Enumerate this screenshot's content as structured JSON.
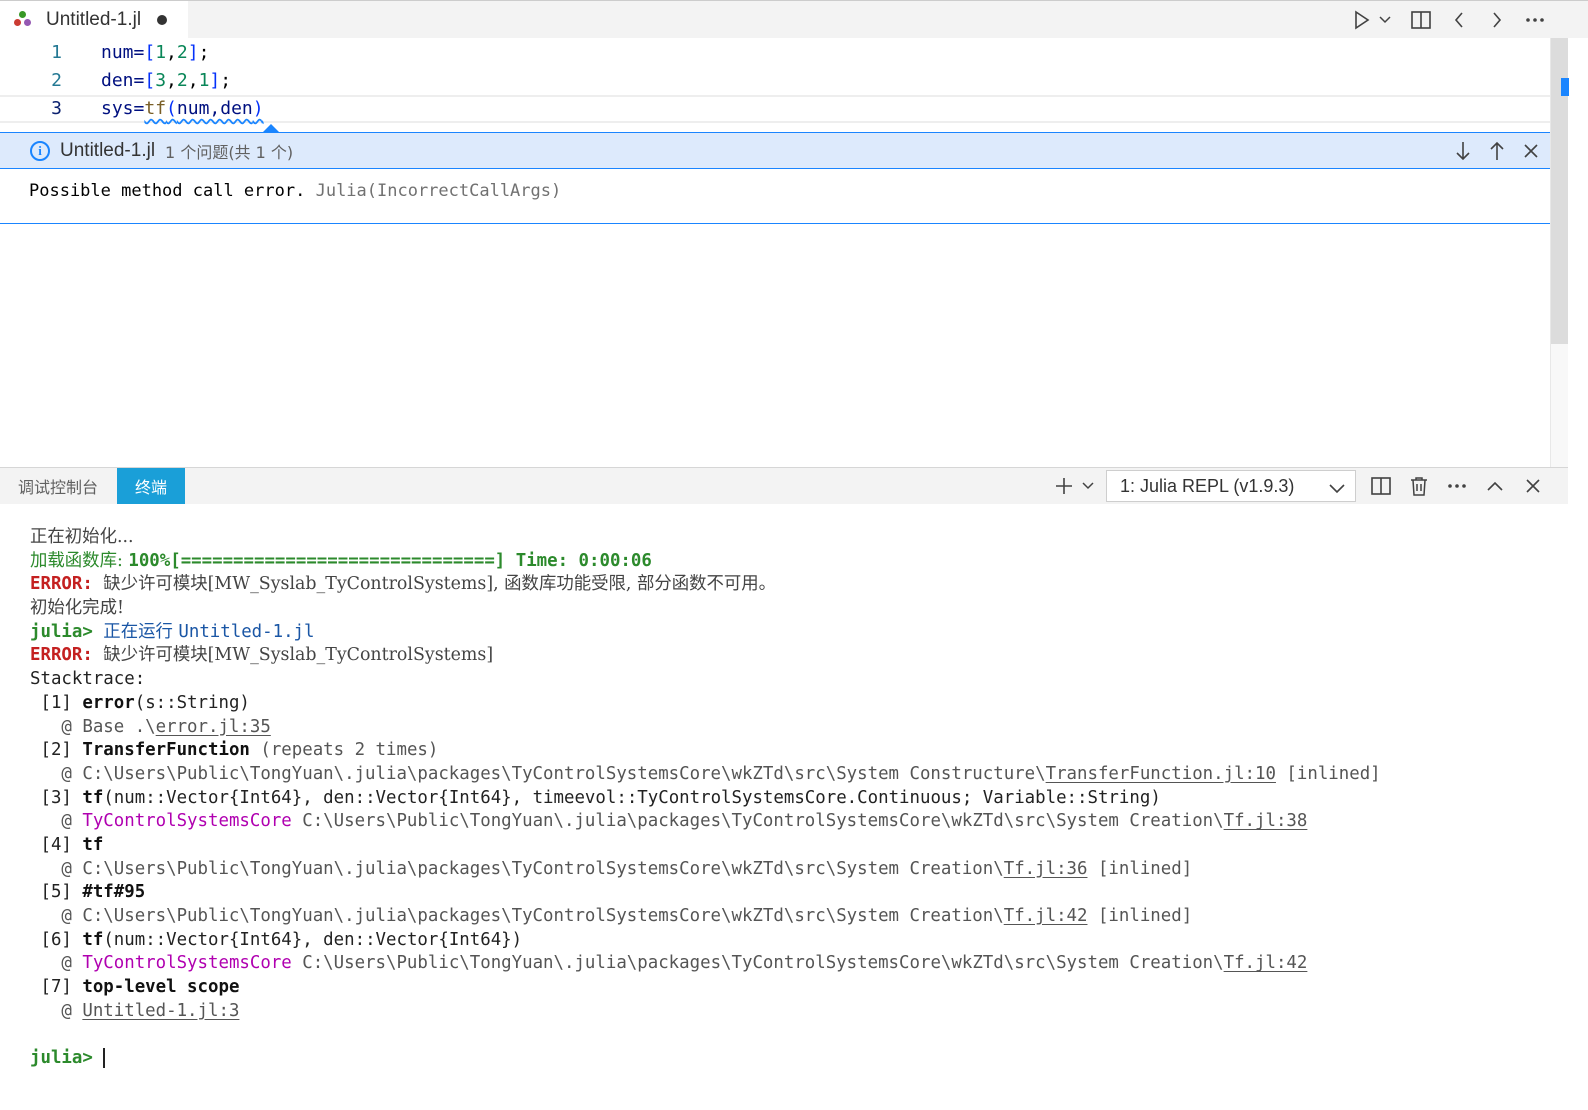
{
  "tab": {
    "title": "Untitled-1.jl"
  },
  "editor": {
    "lines": [
      {
        "no": "1",
        "text": "num=[1,2];"
      },
      {
        "no": "2",
        "text": "den=[3,2,1];"
      },
      {
        "no": "3",
        "text": "sys=tf(num,den)"
      }
    ],
    "tokens": {
      "l1": [
        "num=",
        "[",
        "1",
        ",",
        "2",
        "]",
        ";"
      ],
      "l2": [
        "den=",
        "[",
        "3",
        ",",
        "2",
        ",",
        "1",
        "]",
        ";"
      ],
      "l3": [
        "sys=",
        "tf",
        "(",
        "num,den",
        ")"
      ]
    }
  },
  "problems_peek": {
    "file": "Untitled-1.jl",
    "count": "1 个问题(共 1 个)",
    "message": "Possible method call error.",
    "source": "Julia(IncorrectCallArgs)"
  },
  "panel": {
    "tabs": {
      "debug": "调试控制台",
      "terminal": "终端"
    },
    "terminal_select": "1: Julia REPL (v1.9.3)"
  },
  "terminal": {
    "init": "正在初始化...",
    "loading_label": "加载函数库: ",
    "loading_progress": "100%[==============================]",
    "loading_time": " Time: 0:00:06",
    "error_label": "ERROR: ",
    "error1_msg": "缺少许可模块[MW_Syslab_TyControlSystems], 函数库功能受限, 部分函数不可用。",
    "init_done": "初始化完成!",
    "prompt": "julia> ",
    "running": "正在运行 ",
    "running_file": "Untitled-1.jl",
    "error2_msg": "缺少许可模块[MW_Syslab_TyControlSystems]",
    "stacktrace": "Stacktrace:",
    "frames": {
      "f1_idx": " [1] ",
      "f1_fn": "error",
      "f1_args": "(s::String)",
      "f1_at": "   @ Base .\\",
      "f1_file": "error.jl:35",
      "f2_idx": " [2] ",
      "f2_fn": "TransferFunction",
      "f2_rest": " (repeats 2 times)",
      "f2_at": "   @ C:\\Users\\Public\\TongYuan\\.julia\\packages\\TyControlSystemsCore\\wkZTd\\src\\System Constructure\\",
      "f2_file": "TransferFunction.jl:10",
      "f2_tail": " [inlined]",
      "f3_idx": " [3] ",
      "f3_fn": "tf",
      "f3_args": "(num::Vector{Int64}, den::Vector{Int64}, timeevol::TyControlSystemsCore.Continuous; Variable::String)",
      "f3_at": "   @ ",
      "f3_mod": "TyControlSystemsCore",
      "f3_path": " C:\\Users\\Public\\TongYuan\\.julia\\packages\\TyControlSystemsCore\\wkZTd\\src\\System Creation\\",
      "f3_file": "Tf.jl:38",
      "f4_idx": " [4] ",
      "f4_fn": "tf",
      "f4_at": "   @ C:\\Users\\Public\\TongYuan\\.julia\\packages\\TyControlSystemsCore\\wkZTd\\src\\System Creation\\",
      "f4_file": "Tf.jl:36",
      "f4_tail": " [inlined]",
      "f5_idx": " [5] ",
      "f5_fn": "#tf#95",
      "f5_at": "   @ C:\\Users\\Public\\TongYuan\\.julia\\packages\\TyControlSystemsCore\\wkZTd\\src\\System Creation\\",
      "f5_file": "Tf.jl:42",
      "f5_tail": " [inlined]",
      "f6_idx": " [6] ",
      "f6_fn": "tf",
      "f6_args": "(num::Vector{Int64}, den::Vector{Int64})",
      "f6_at": "   @ ",
      "f6_mod": "TyControlSystemsCore",
      "f6_path": " C:\\Users\\Public\\TongYuan\\.julia\\packages\\TyControlSystemsCore\\wkZTd\\src\\System Creation\\",
      "f6_file": "Tf.jl:42",
      "f7_idx": " [7] ",
      "f7_fn": "top-level scope",
      "f7_at": "   @ ",
      "f7_file": "Untitled-1.jl:3"
    }
  },
  "icons": {
    "file_icon": "julia-file-icon",
    "run": "run-icon",
    "split": "split-editor-icon",
    "back": "chevron-left-icon",
    "forward": "chevron-right-icon",
    "more": "more-icon",
    "add": "plus-icon",
    "trash": "trash-icon",
    "maximize": "chevron-up-icon",
    "close": "close-icon"
  },
  "colors": {
    "accent": "#1a9fd8",
    "error": "#c42020",
    "ok": "#2c8a2c",
    "module": "#b000b0",
    "peek_border": "#1a85ff"
  }
}
